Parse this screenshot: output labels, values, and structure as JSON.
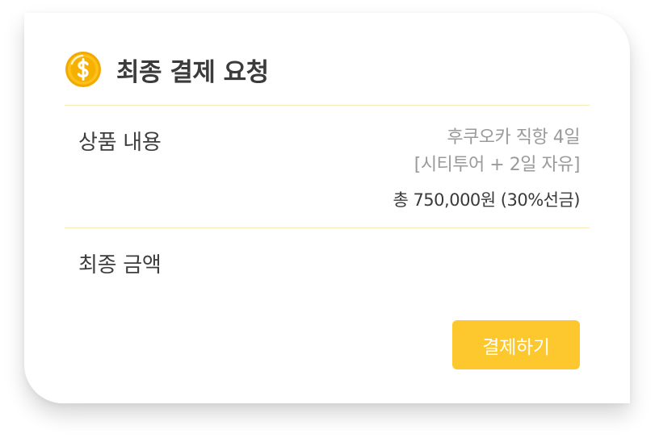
{
  "header": {
    "icon": "coin-dollar-icon",
    "title": "최종 결제 요청"
  },
  "product": {
    "label": "상품 내용",
    "line1": "후쿠오카 직항 4일",
    "line2": "[시티투어 + 2일 자유]",
    "price": "총 750,000원 (30%선금)"
  },
  "final": {
    "label": "최종 금액"
  },
  "actions": {
    "pay_label": "결제하기"
  },
  "colors": {
    "accent": "#fdc72e",
    "divider": "#fbe9b8",
    "coin": "#f5b500"
  }
}
